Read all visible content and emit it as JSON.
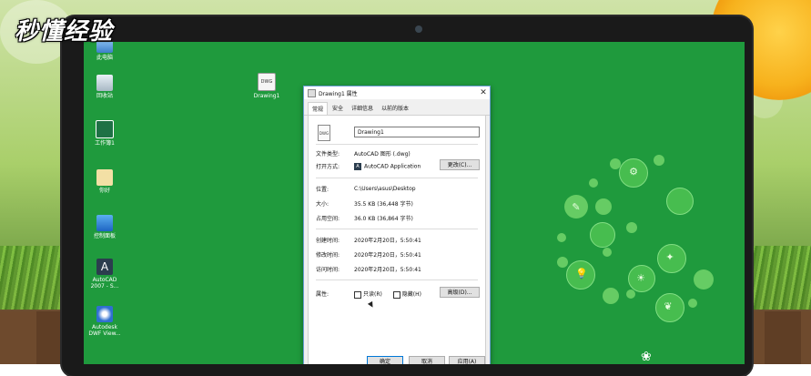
{
  "watermark": {
    "text": "秒懂经验"
  },
  "desktop_icons": [
    {
      "label": "此电脑",
      "icon": "computer-icon"
    },
    {
      "label": "回收站",
      "icon": "recycle-bin-icon"
    },
    {
      "label": "工作簿1",
      "icon": "excel-file-icon"
    },
    {
      "label": "你好",
      "icon": "folder-icon"
    },
    {
      "label": "控制面板",
      "icon": "control-panel-icon"
    },
    {
      "label": "AutoCAD 2007 - S...",
      "icon": "autocad-icon"
    },
    {
      "label": "Autodesk DWF View...",
      "icon": "dwf-viewer-icon"
    },
    {
      "label": "Drawing1",
      "icon": "dwg-file-icon"
    }
  ],
  "dialog": {
    "title": "Drawing1 属性",
    "tabs": [
      "常规",
      "安全",
      "详细信息",
      "以前的版本"
    ],
    "active_tab": "常规",
    "file_icon_text": "DWG",
    "file_name": "Drawing1",
    "file_type_label": "文件类型:",
    "file_type_value": "AutoCAD 图形 (.dwg)",
    "open_with_label": "打开方式:",
    "open_with_value": "AutoCAD Application",
    "change_button": "更改(C)...",
    "location_label": "位置:",
    "location_value": "C:\\Users\\asus\\Desktop",
    "size_label": "大小:",
    "size_value": "35.5 KB (36,448 字节)",
    "size_on_disk_label": "占用空间:",
    "size_on_disk_value": "36.0 KB (36,864 字节)",
    "created_label": "创建时间:",
    "created_value": "2020年2月20日，5:50:41",
    "modified_label": "修改时间:",
    "modified_value": "2020年2月20日，5:50:41",
    "accessed_label": "访问时间:",
    "accessed_value": "2020年2月20日，5:50:41",
    "attributes_label": "属性:",
    "readonly_label": "只读(R)",
    "hidden_label": "隐藏(H)",
    "advanced_button": "高级(D)...",
    "ok_button": "确定",
    "cancel_button": "取消",
    "apply_button": "应用(A)"
  },
  "colors": {
    "desktop": "#1f9a3d",
    "bulb": "#6ed268",
    "dialog_border": "#6a9fd4"
  }
}
